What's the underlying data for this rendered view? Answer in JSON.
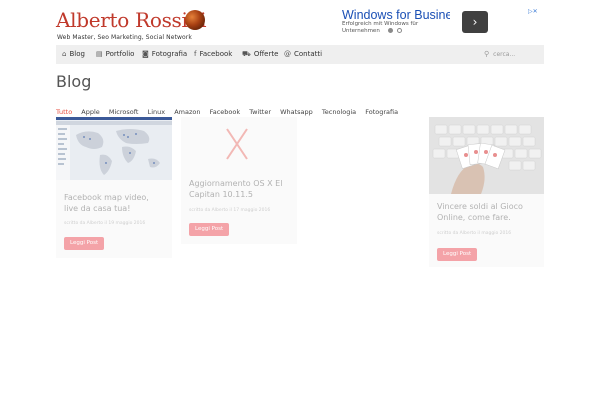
{
  "header": {
    "logo_name": "Alberto Rossini",
    "tagline": "Web Master, Seo Marketing, Social Network"
  },
  "ad": {
    "title": "Windows for Business",
    "subtitle": "Erfolgreich mit Windows für Unternehmen",
    "arrow": "›",
    "choices": "▷✕"
  },
  "nav": {
    "items": [
      {
        "icon": "⌂",
        "label": "Blog"
      },
      {
        "icon": "▤",
        "label": "Portfolio"
      },
      {
        "icon": "◙",
        "label": "Fotografia"
      },
      {
        "icon": "f",
        "label": "Facebook"
      },
      {
        "icon": "⛟",
        "label": "Offerte"
      },
      {
        "icon": "@",
        "label": "Contatti"
      }
    ],
    "search_icon": "⚲",
    "search_placeholder": "cerca..."
  },
  "page": {
    "title": "Blog"
  },
  "filters": [
    "Tutto",
    "Apple",
    "Microsoft",
    "Linux",
    "Amazon",
    "Facebook",
    "Twitter",
    "Whatsapp",
    "Tecnologia",
    "Fotografia"
  ],
  "posts": [
    {
      "title": "Facebook map video, live da casa tua!",
      "meta": "scritto da Alberto il 19 maggio 2016",
      "button": "Leggi Post"
    },
    {
      "title": "Aggiornamento OS X El Capitan 10.11.5",
      "meta": "scritto da Alberto il 17 maggio 2016",
      "button": "Leggi Post"
    },
    {
      "title": "Vincere soldi al Gioco Online, come fare.",
      "meta": "scritto da Alberto il maggio 2016",
      "button": "Leggi Post"
    }
  ],
  "colors": {
    "accent": "#e74c3c",
    "button": "#f4a3a8",
    "nav_bg": "#efefef",
    "logo": "#c0392b"
  }
}
